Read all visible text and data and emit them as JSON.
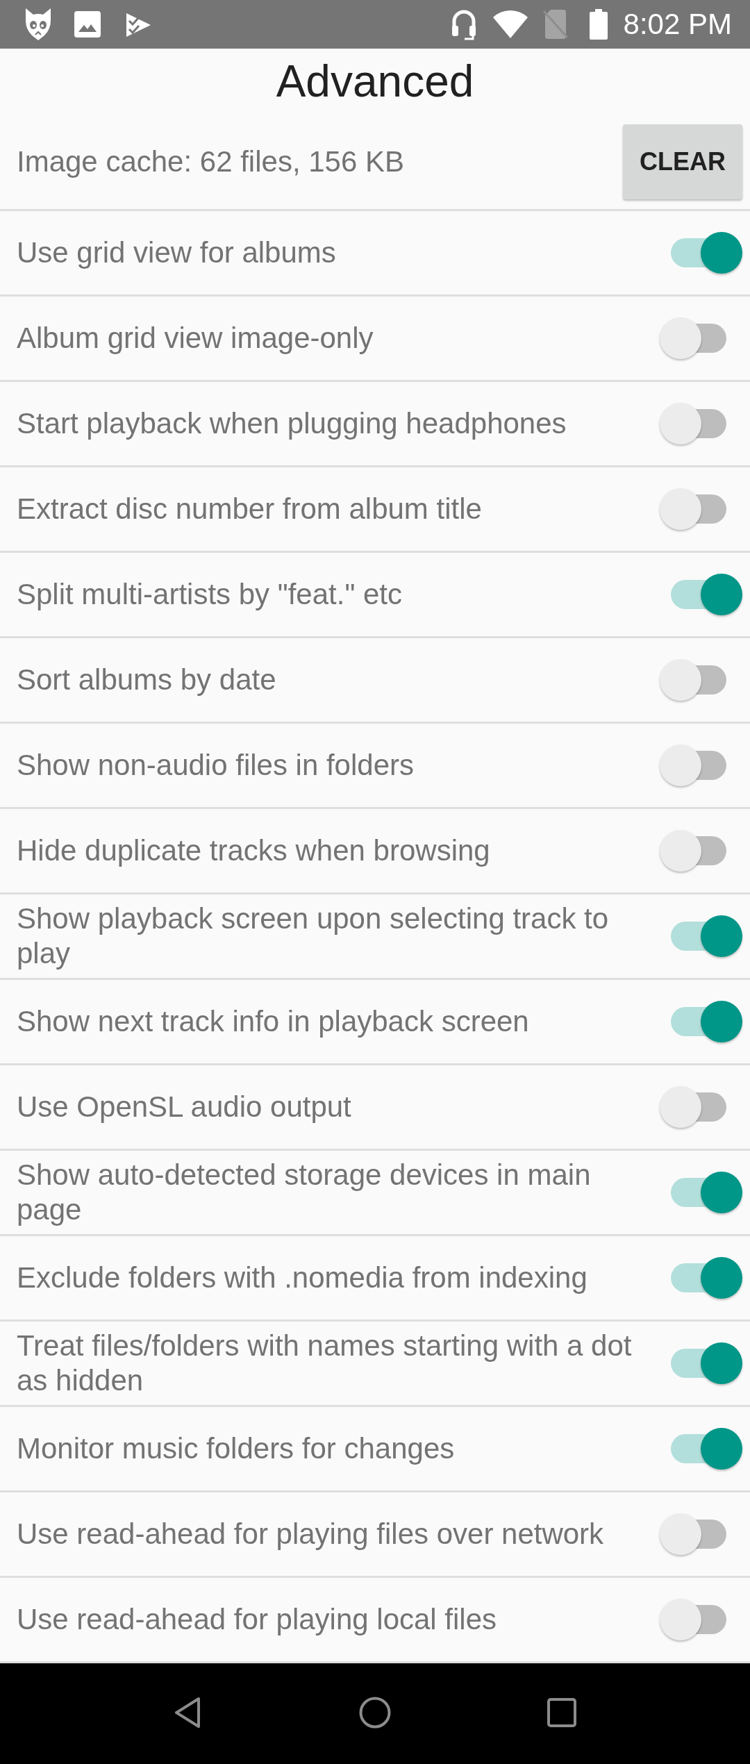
{
  "status_bar": {
    "time": "8:02 PM"
  },
  "title": "Advanced",
  "image_cache": {
    "label": "Image cache: 62 files, 156 KB",
    "button": "CLEAR"
  },
  "settings": [
    {
      "label": "Use grid view for albums",
      "on": true
    },
    {
      "label": "Album grid view image-only",
      "on": false
    },
    {
      "label": "Start playback when plugging headphones",
      "on": false
    },
    {
      "label": "Extract disc number from album title",
      "on": false
    },
    {
      "label": "Split multi-artists by \"feat.\" etc",
      "on": true
    },
    {
      "label": "Sort albums by date",
      "on": false
    },
    {
      "label": "Show non-audio files in folders",
      "on": false
    },
    {
      "label": "Hide duplicate tracks when browsing",
      "on": false
    },
    {
      "label": "Show playback screen upon selecting track to play",
      "on": true
    },
    {
      "label": "Show next track info in playback screen",
      "on": true
    },
    {
      "label": "Use OpenSL audio output",
      "on": false
    },
    {
      "label": "Show auto-detected storage devices in main page",
      "on": true
    },
    {
      "label": "Exclude folders with .nomedia from indexing",
      "on": true
    },
    {
      "label": "Treat files/folders with names starting with a dot as hidden",
      "on": true
    },
    {
      "label": "Monitor music folders for changes",
      "on": true
    },
    {
      "label": "Use read-ahead for playing files over network",
      "on": false
    },
    {
      "label": "Use read-ahead for playing local files",
      "on": false
    }
  ]
}
